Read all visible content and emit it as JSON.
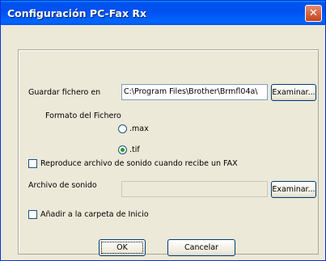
{
  "window": {
    "title": "Configuración PC-Fax Rx"
  },
  "save_file": {
    "label": "Guardar fichero en",
    "path": "C:\\Program Files\\Brother\\Brmfl04a\\",
    "browse": "Examinar..."
  },
  "file_format": {
    "label": "Formato del Fichero",
    "options": [
      ".max",
      ".tif"
    ],
    "selected": ".tif"
  },
  "play_sound_checkbox": {
    "label": "Reproduce archivo de sonido cuando recibe un FAX",
    "checked": false
  },
  "sound_file": {
    "label": "Archivo de sonido",
    "value": "",
    "browse": "Examinar..."
  },
  "startup_checkbox": {
    "label": "Añadir a la carpeta de Inicio",
    "checked": false
  },
  "buttons": {
    "ok": "OK",
    "cancel": "Cancelar"
  }
}
